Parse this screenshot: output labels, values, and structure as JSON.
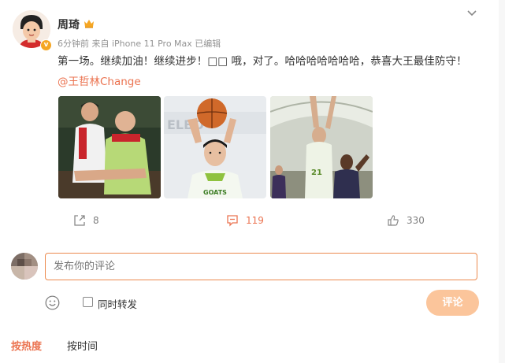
{
  "post": {
    "author": "周琦",
    "meta": "6分钟前  来自 iPhone 11 Pro Max 已编辑",
    "content": "第一场。继续加油！继续进步！□□ 哦，对了。哈哈哈哈哈哈哈，恭喜大王最佳防守！",
    "mention": "@王哲林Change"
  },
  "actions": {
    "share_count": "8",
    "comment_count": "119",
    "like_count": "330"
  },
  "comment_box": {
    "placeholder": "发布你的评论",
    "repost_label": "同时转发",
    "submit_label": "评论"
  },
  "sort": {
    "hot": "按热度",
    "time": "按时间"
  },
  "colors": {
    "accent": "#eb7350",
    "submit_bg": "#fbc59b",
    "input_border": "#ec8a4e"
  }
}
